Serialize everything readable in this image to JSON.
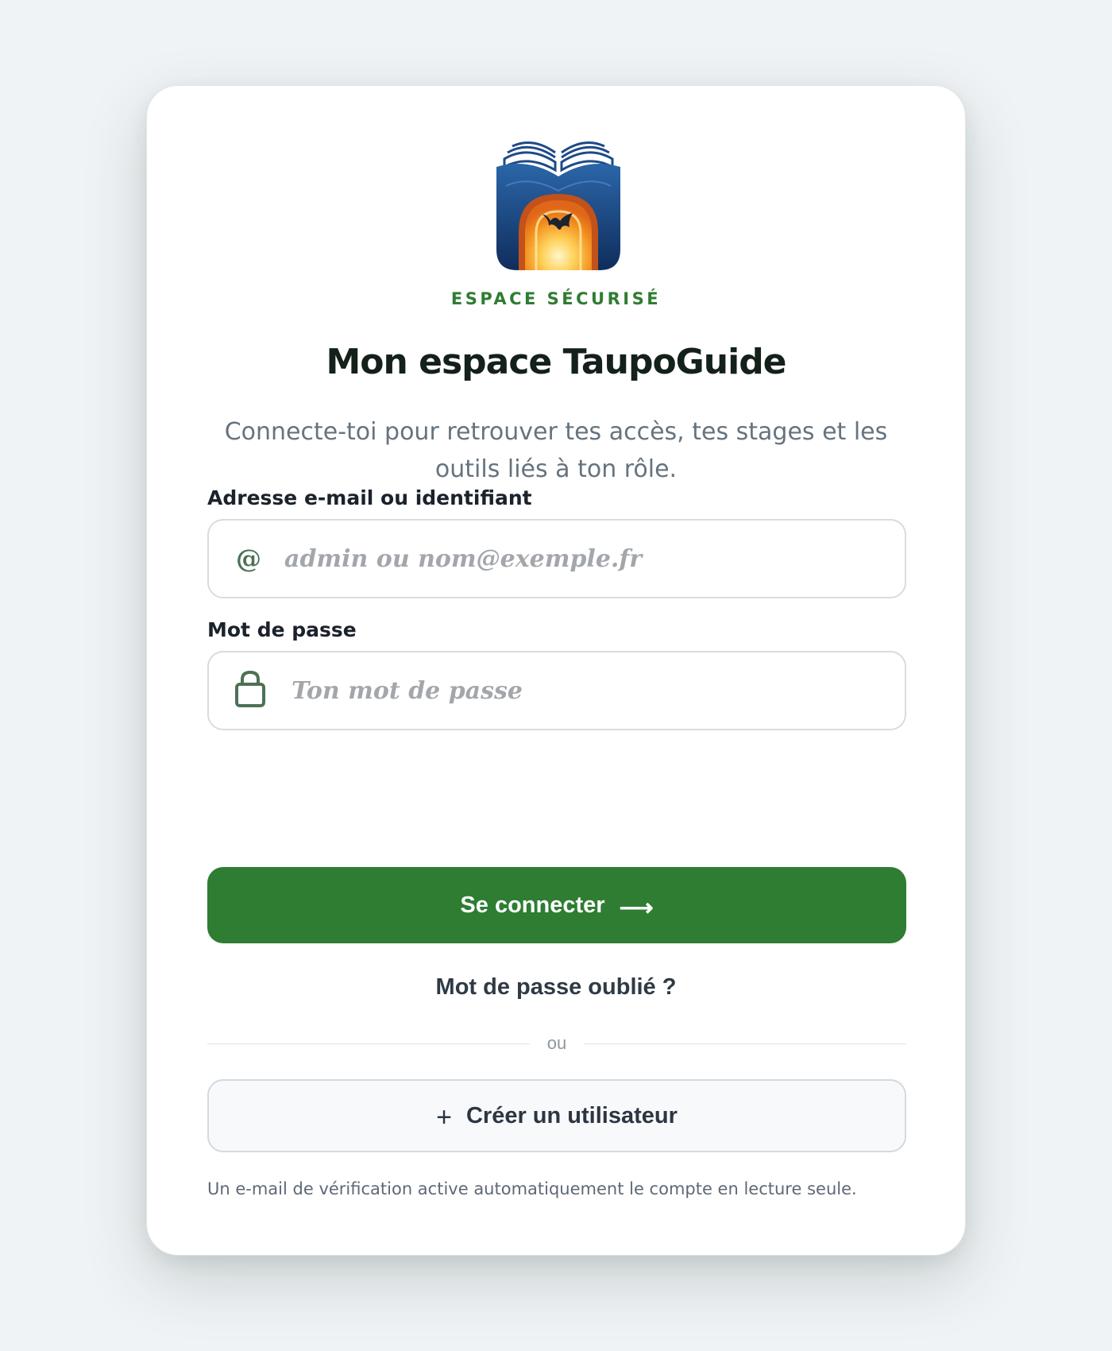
{
  "eyebrow": "ESPACE SÉCURISÉ",
  "title": "Mon espace TaupoGuide",
  "subtitle": "Connecte-toi pour retrouver tes accès, tes stages et les outils liés à ton rôle.",
  "login": {
    "identifier_label": "Adresse e-mail ou identifiant",
    "identifier_icon": "at-sign-icon",
    "identifier_glyph": "@",
    "identifier_placeholder": "admin ou nom@exemple.fr",
    "identifier_value": "",
    "password_label": "Mot de passe",
    "password_icon": "lock-icon",
    "password_placeholder": "Ton mot de passe",
    "password_value": ""
  },
  "actions": {
    "submit_label": "Se connecter",
    "submit_icon": "arrow-right-icon",
    "submit_glyph": "⟶",
    "forgot_label": "Mot de passe oublié ?",
    "divider_label": "ou",
    "create_icon": "plus-icon",
    "create_glyph": "+",
    "create_label": "Créer un utilisateur"
  },
  "note": "Un e-mail de vérification active automatiquement le compte en lecture seule.",
  "colors": {
    "accent": "#2e7d32",
    "background": "#f0f3f6",
    "logo_blue": "#1d4a86",
    "logo_orange": "#f28c1c"
  }
}
